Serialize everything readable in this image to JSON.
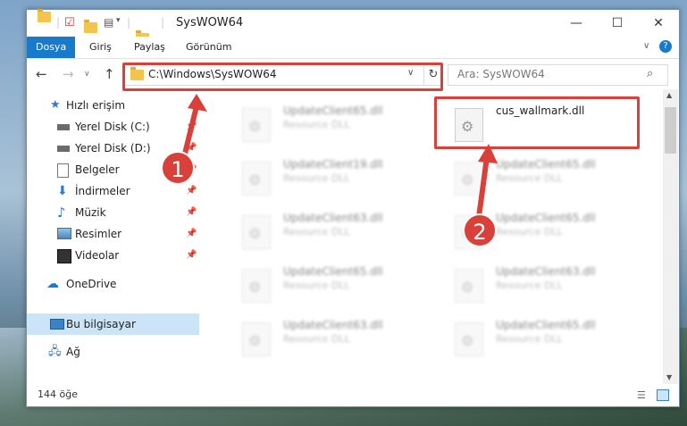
{
  "window": {
    "title": "SysWOW64"
  },
  "ribbon": {
    "tabs": [
      "Dosya",
      "Giriş",
      "Paylaş",
      "Görünüm"
    ]
  },
  "address": {
    "path": "C:\\Windows\\SysWOW64",
    "search_placeholder": "Ara: SysWOW64"
  },
  "nav": {
    "items": [
      {
        "label": "Hızlı erişim",
        "icon": "star-icon"
      },
      {
        "label": "Yerel Disk (C:)",
        "icon": "drive-icon",
        "pinned": true
      },
      {
        "label": "Yerel Disk (D:)",
        "icon": "drive-icon",
        "pinned": true
      },
      {
        "label": "Belgeler",
        "icon": "document-icon",
        "pinned": true
      },
      {
        "label": "İndirmeler",
        "icon": "download-icon",
        "pinned": true
      },
      {
        "label": "Müzik",
        "icon": "music-icon",
        "pinned": true
      },
      {
        "label": "Resimler",
        "icon": "pictures-icon",
        "pinned": true
      },
      {
        "label": "Videolar",
        "icon": "video-icon",
        "pinned": true
      },
      {
        "label": "OneDrive",
        "icon": "cloud-icon"
      },
      {
        "label": "Bu bilgisayar",
        "icon": "computer-icon",
        "selected": true
      },
      {
        "label": "Ağ",
        "icon": "network-icon"
      }
    ]
  },
  "files": [
    {
      "name": "UpdateClient65.dll",
      "type": "Resource DLL",
      "blurred": true
    },
    {
      "name": "cus_wallmark.dll",
      "type": "",
      "blurred": false
    },
    {
      "name": "UpdateClient19.dll",
      "type": "Resource DLL",
      "blurred": true
    },
    {
      "name": "UpdateClient65.dll",
      "type": "Resource DLL",
      "blurred": true
    },
    {
      "name": "UpdateClient63.dll",
      "type": "Resource DLL",
      "blurred": true
    },
    {
      "name": "UpdateClient65.dll",
      "type": "Resource DLL",
      "blurred": true
    },
    {
      "name": "UpdateClient65.dll",
      "type": "Resource DLL",
      "blurred": true
    },
    {
      "name": "UpdateClient63.dll",
      "type": "Resource DLL",
      "blurred": true
    },
    {
      "name": "UpdateClient63.dll",
      "type": "Resource DLL",
      "blurred": true
    },
    {
      "name": "UpdateClient65.dll",
      "type": "Resource DLL",
      "blurred": true
    }
  ],
  "status": {
    "count": "144 öğe"
  },
  "annotations": {
    "badge1": "1",
    "badge2": "2",
    "color": "#d9403a"
  }
}
